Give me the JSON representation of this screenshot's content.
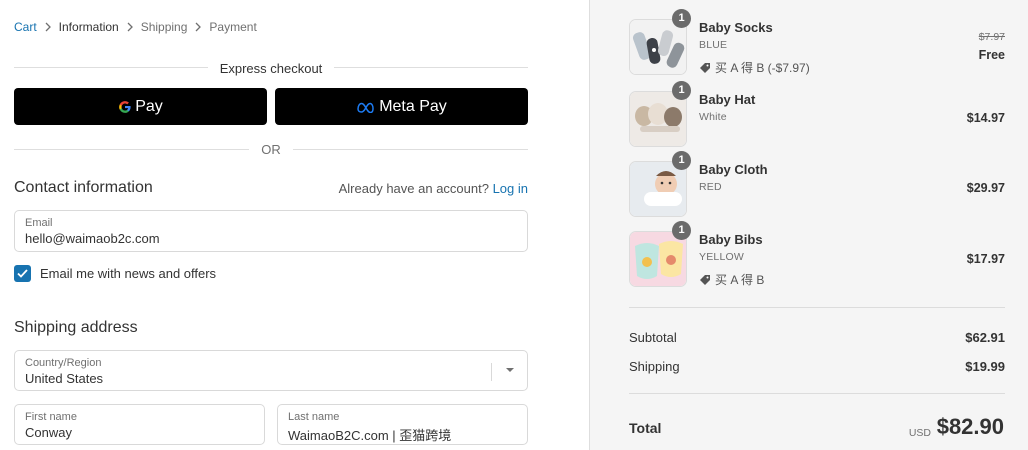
{
  "breadcrumb": {
    "items": [
      "Cart",
      "Information",
      "Shipping",
      "Payment"
    ]
  },
  "express": {
    "title": "Express checkout",
    "gpay_label": "Pay",
    "metapay_label": "Meta Pay",
    "or_label": "OR"
  },
  "contact": {
    "heading": "Contact information",
    "account_prompt": "Already have an account?",
    "login_link": "Log in",
    "email_label": "Email",
    "email_value": "hello@waimaob2c.com",
    "newsletter_label": "Email me with news and offers",
    "newsletter_checked": true
  },
  "shipping": {
    "heading": "Shipping address",
    "country_label": "Country/Region",
    "country_value": "United States",
    "first_name_label": "First name",
    "first_name_value": "Conway",
    "last_name_label": "Last name",
    "last_name_value": "WaimaoB2C.com | 歪猫跨境"
  },
  "order": {
    "items": [
      {
        "qty": "1",
        "name": "Baby Socks",
        "variant": "BLUE",
        "discount": "买 A 得 B (-$7.97)",
        "old_price": "$7.97",
        "price": "Free",
        "icon": "tag-icon"
      },
      {
        "qty": "1",
        "name": "Baby Hat",
        "variant": "White",
        "price": "$14.97"
      },
      {
        "qty": "1",
        "name": "Baby Cloth",
        "variant": "RED",
        "price": "$29.97"
      },
      {
        "qty": "1",
        "name": "Baby Bibs",
        "variant": "YELLOW",
        "discount": "买 A 得 B",
        "price": "$17.97",
        "icon": "tag-icon"
      }
    ],
    "subtotal_label": "Subtotal",
    "subtotal_value": "$62.91",
    "shipping_label": "Shipping",
    "shipping_value": "$19.99",
    "total_label": "Total",
    "currency": "USD",
    "total_value": "$82.90"
  },
  "colors": {
    "accent": "#1773b0",
    "button_bg": "#000000",
    "sidebar_bg": "#f5f5f5"
  }
}
